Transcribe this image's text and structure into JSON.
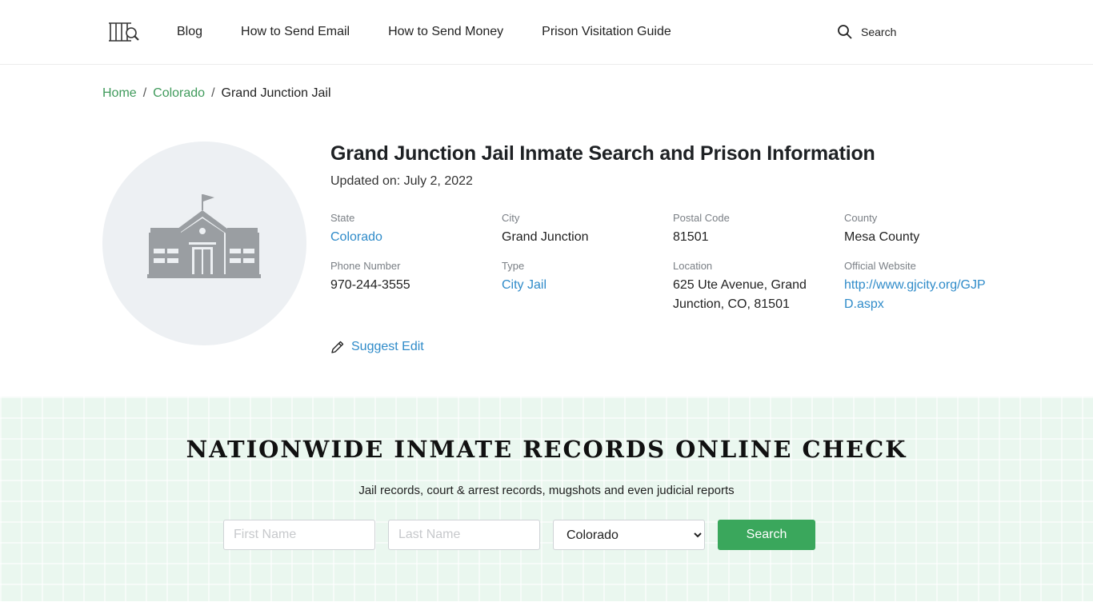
{
  "nav": {
    "items": [
      "Blog",
      "How to Send Email",
      "How to Send Money",
      "Prison Visitation Guide"
    ],
    "search_label": "Search"
  },
  "breadcrumb": {
    "home": "Home",
    "state": "Colorado",
    "current": "Grand Junction Jail",
    "separator": "/"
  },
  "facility": {
    "title": "Grand Junction Jail Inmate Search and Prison Information",
    "updated": "Updated on: July 2, 2022",
    "fields": [
      {
        "label": "State",
        "value": "Colorado"
      },
      {
        "label": "City",
        "value": "Grand Junction"
      },
      {
        "label": "Postal Code",
        "value": "81501"
      },
      {
        "label": "County",
        "value": "Mesa County"
      },
      {
        "label": "Phone Number",
        "value": "970-244-3555"
      },
      {
        "label": "Type",
        "value": "City Jail"
      },
      {
        "label": "Location",
        "value": "625 Ute Avenue, Grand Junction, CO, 81501"
      },
      {
        "label": "Official Website",
        "value": "http://www.gjcity.org/GJPD.aspx"
      }
    ],
    "suggest_edit": "Suggest Edit"
  },
  "banner": {
    "title": "NATIONWIDE INMATE RECORDS ONLINE CHECK",
    "subtitle": "Jail records, court & arrest records, mugshots and even judicial reports",
    "first_name_placeholder": "First Name",
    "last_name_placeholder": "Last Name",
    "state_selected": "Colorado",
    "search_button": "Search"
  },
  "colors": {
    "link_green": "#3f9a5b",
    "link_blue": "#2f8bc9",
    "button_green": "#3aa75c",
    "banner_bg": "#eaf7ef"
  },
  "icons": [
    "jail-logo-icon",
    "search-icon",
    "building-icon",
    "pencil-icon"
  ]
}
